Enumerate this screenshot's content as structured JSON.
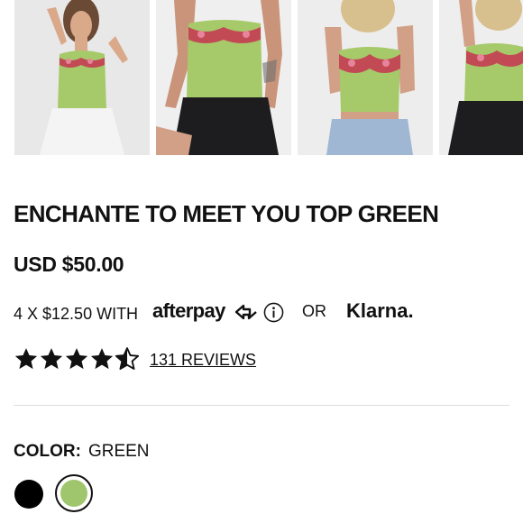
{
  "gallery": {
    "thumbnails": [
      {
        "alt": "model-front-white-skirt",
        "selected": true
      },
      {
        "alt": "model-sitting-black-skirt",
        "selected": false
      },
      {
        "alt": "model-front-jeans",
        "selected": false
      },
      {
        "alt": "model-partial-black-skirt",
        "selected": false
      }
    ]
  },
  "product": {
    "title": "ENCHANTE TO MEET YOU TOP GREEN",
    "price": "USD $50.00"
  },
  "payment": {
    "installment_text": "4 X $12.50 WITH",
    "afterpay_logo": "afterpay",
    "or_text": "OR",
    "klarna_logo": "Klarna."
  },
  "rating": {
    "value": 4.5,
    "max": 5,
    "reviews_label": "131 REVIEWS"
  },
  "color": {
    "label": "COLOR:",
    "selected_value": "GREEN",
    "swatches": [
      {
        "name": "Black",
        "hex": "#000000"
      },
      {
        "name": "Green",
        "hex": "#9fc66c",
        "selected": true
      }
    ]
  },
  "colors": {
    "top_green": "#a6c96a",
    "text": "#111111",
    "divider": "#dddddd"
  }
}
